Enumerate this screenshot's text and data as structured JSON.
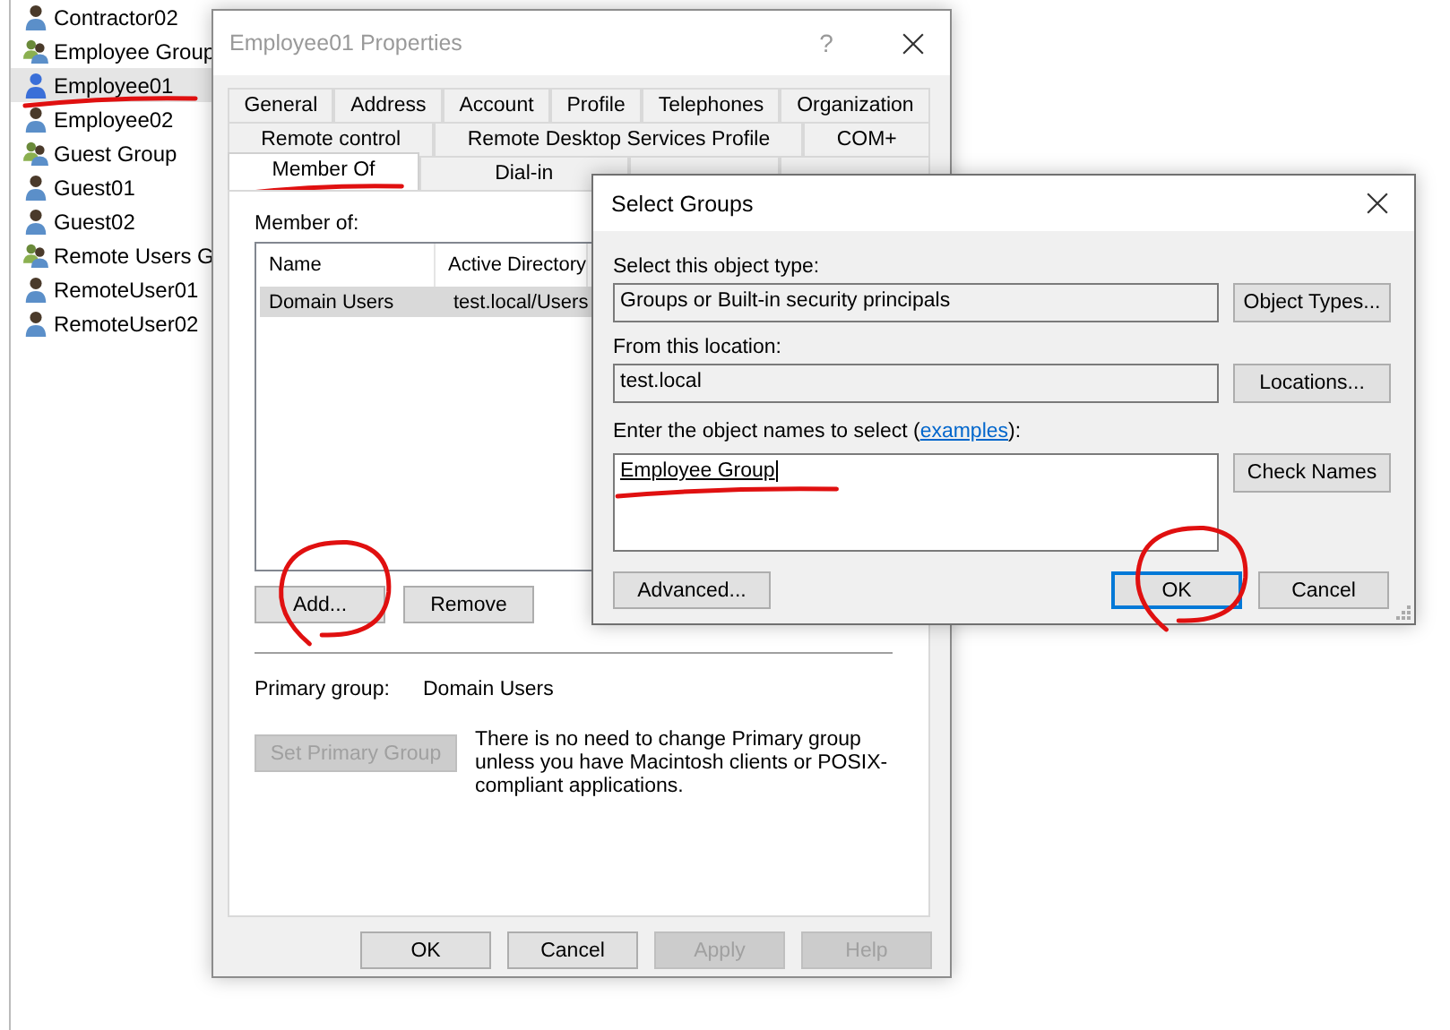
{
  "background_list": {
    "items": [
      {
        "name": "Contractor02",
        "kind": "user",
        "selected": false,
        "underlined": false
      },
      {
        "name": "Employee Group",
        "kind": "group",
        "selected": false,
        "underlined": false
      },
      {
        "name": "Employee01",
        "kind": "user",
        "selected": true,
        "underlined": true
      },
      {
        "name": "Employee02",
        "kind": "user",
        "selected": false,
        "underlined": false
      },
      {
        "name": "Guest Group",
        "kind": "group",
        "selected": false,
        "underlined": false
      },
      {
        "name": "Guest01",
        "kind": "user",
        "selected": false,
        "underlined": false
      },
      {
        "name": "Guest02",
        "kind": "user",
        "selected": false,
        "underlined": false
      },
      {
        "name": "Remote Users G",
        "kind": "group",
        "selected": false,
        "underlined": false
      },
      {
        "name": "RemoteUser01",
        "kind": "user",
        "selected": false,
        "underlined": false
      },
      {
        "name": "RemoteUser02",
        "kind": "user",
        "selected": false,
        "underlined": false
      }
    ]
  },
  "properties_window": {
    "title": "Employee01 Properties",
    "help_button": "?",
    "tab_rows": [
      [
        {
          "label": "General",
          "selected": false,
          "underlined": false
        },
        {
          "label": "Address",
          "selected": false,
          "underlined": false
        },
        {
          "label": "Account",
          "selected": false,
          "underlined": false
        },
        {
          "label": "Profile",
          "selected": false,
          "underlined": false
        },
        {
          "label": "Telephones",
          "selected": false,
          "underlined": false
        },
        {
          "label": "Organization",
          "selected": false,
          "underlined": false
        }
      ],
      [
        {
          "label": "Remote control",
          "selected": false,
          "underlined": false
        },
        {
          "label": "Remote Desktop Services Profile",
          "selected": false,
          "underlined": false
        },
        {
          "label": "COM+",
          "selected": false,
          "underlined": false
        }
      ],
      [
        {
          "label": "Member Of",
          "selected": true,
          "underlined": true
        },
        {
          "label": "Dial-in",
          "selected": false,
          "underlined": false
        },
        {
          "selected": false
        },
        {
          "selected": false
        }
      ]
    ],
    "member_of_label": "Member of:",
    "list": {
      "columns": [
        "Name",
        "Active Directory"
      ],
      "rows": [
        {
          "cells": [
            "Domain Users",
            "test.local/Users"
          ],
          "selected": true
        }
      ]
    },
    "list_buttons": [
      {
        "label": "Add...",
        "disabled": false,
        "circled": true
      },
      {
        "label": "Remove",
        "disabled": false,
        "circled": false
      }
    ],
    "primary_group_label": "Primary group:",
    "primary_group_value": "Domain Users",
    "set_primary_button": {
      "label": "Set Primary Group",
      "disabled": true
    },
    "note": "There is no need to change Primary group unless you have Macintosh clients or POSIX-compliant applications.",
    "footer_buttons": [
      {
        "label": "OK",
        "disabled": false
      },
      {
        "label": "Cancel",
        "disabled": false
      },
      {
        "label": "Apply",
        "disabled": true
      },
      {
        "label": "Help",
        "disabled": true
      }
    ]
  },
  "select_groups_dialog": {
    "title": "Select Groups",
    "object_type_label": "Select this object type:",
    "object_type_value": "Groups or Built-in security principals",
    "object_types_button": "Object Types...",
    "location_label": "From this location:",
    "location_value": "test.local",
    "locations_button": "Locations...",
    "names_label_before": "Enter the object names to select (",
    "names_link": "examples",
    "names_label_after": "):",
    "names_value": "Employee Group",
    "names_underlined": true,
    "check_names_button": "Check Names",
    "buttons": [
      {
        "label": "Advanced...",
        "default": false,
        "circled": false
      },
      {
        "label": "OK",
        "default": true,
        "circled": true
      },
      {
        "label": "Cancel",
        "default": false,
        "circled": false
      }
    ]
  }
}
